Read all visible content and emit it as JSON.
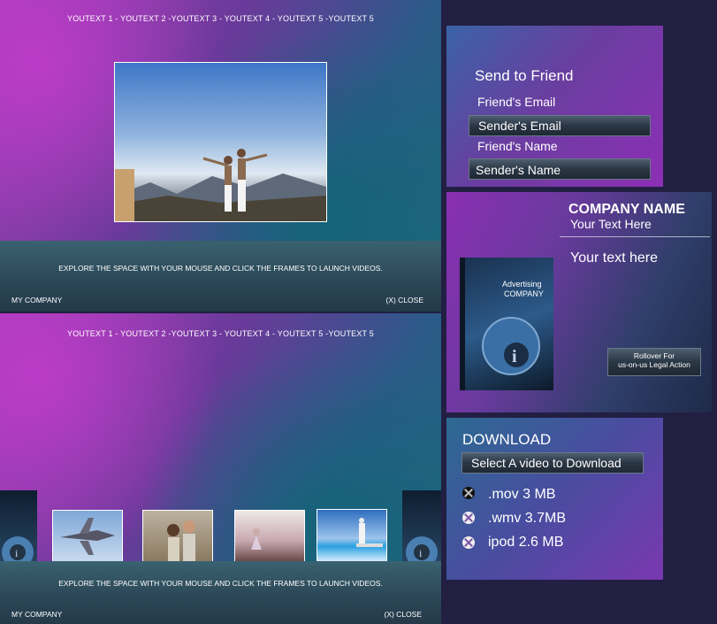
{
  "player_top": {
    "nav": "YOUTEXT 1 - YOUTEXT 2 -YOUTEXT 3 - YOUTEXT 4 - YOUTEXT 5 -YOUTEXT 5",
    "hint": "EXPLORE THE SPACE WITH YOUR MOUSE AND CLICK THE FRAMES TO LAUNCH VIDEOS.",
    "company": "MY COMPANY",
    "close": "(X) CLOSE"
  },
  "player_bottom": {
    "nav": "YOUTEXT 1 - YOUTEXT 2 -YOUTEXT 3 - YOUTEXT 4 - YOUTEXT 5 -YOUTEXT 5",
    "hint": "EXPLORE THE SPACE WITH YOUR MOUSE AND CLICK THE FRAMES TO LAUNCH VIDEOS.",
    "company": "MY COMPANY",
    "close": "(X) CLOSE"
  },
  "send_to_friend": {
    "title": "Send to Friend",
    "fields": [
      "Friend's Email",
      "Sender's Email",
      "Friend's Name",
      "Sender's Name"
    ]
  },
  "company_card": {
    "name": "COMPANY NAME",
    "subtitle": "Your Text Here",
    "body": "Your text here",
    "box_line1": "Advertising",
    "box_line2": "COMPANY",
    "rollover_line1": "Rollover For",
    "rollover_line2": "us-on-us Legal Action"
  },
  "download": {
    "title": "DOWNLOAD",
    "select_label": "Select A video to Download",
    "options": [
      ".mov 3 MB",
      ".wmv 3.7MB",
      "ipod 2.6 MB"
    ]
  },
  "colors": {
    "background": "#221f43",
    "accent_purple": "#a03fb8",
    "accent_teal": "#1d6a7a"
  }
}
